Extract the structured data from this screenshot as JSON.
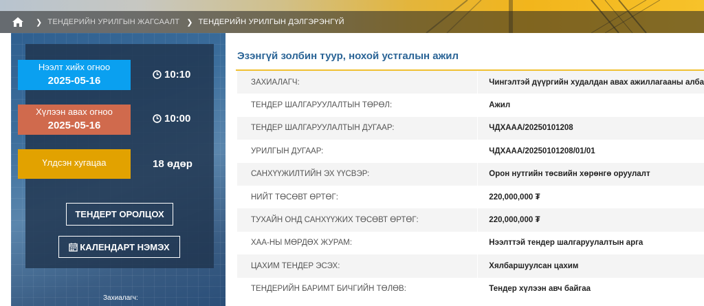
{
  "breadcrumb": {
    "items": [
      {
        "label": "ТЕНДЕРИЙН УРИЛГЫН ЖАГСААЛТ"
      },
      {
        "label": "ТЕНДЕРИЙН УРИЛГЫН ДЭЛГЭРЭНГҮЙ"
      }
    ]
  },
  "schedule": {
    "start": {
      "label": "Нээлт хийх огноо",
      "date": "2025-05-16",
      "time": "10:10",
      "color": "#0aa0f0"
    },
    "end": {
      "label": "Хүлээн авах огноо",
      "date": "2025-05-16",
      "time": "10:00",
      "color": "#d06a4d"
    },
    "remaining": {
      "label": "Үлдсэн хугацаа",
      "value": "18 өдөр",
      "color": "#e2a200"
    }
  },
  "actions": {
    "join_label": "ТЕНДЕРТ ОРОЛЦОХ",
    "calendar_label": "КАЛЕНДАРТ НЭМЭХ"
  },
  "sidebar_footer": {
    "customer_label": "Захиалагч:"
  },
  "tender": {
    "title": "Эзэнгүй золбин туур, нохой устгалын ажил",
    "rows": [
      {
        "key": "ЗАХИАЛАГЧ:",
        "value": "Чингэлтэй дүүргийн худалдан авах ажиллагааны алба"
      },
      {
        "key": "ТЕНДЕР ШАЛГАРУУЛАЛТЫН ТӨРӨЛ:",
        "value": "Ажил"
      },
      {
        "key": "ТЕНДЕР ШАЛГАРУУЛАЛТЫН ДУГААР:",
        "value": "ЧДХААА/20250101208"
      },
      {
        "key": "УРИЛГЫН ДУГААР:",
        "value": "ЧДХААА/20250101208/01/01"
      },
      {
        "key": "САНХҮҮЖИЛТИЙН ЭХ ҮҮСВЭР:",
        "value": "Орон нутгийн төсвийн хөрөнгө оруулалт"
      },
      {
        "key": "НИЙТ ТӨСӨВТ ӨРТӨГ:",
        "value": "220,000,000 ₮"
      },
      {
        "key": "ТУХАЙН ОНД САНХҮҮЖИХ ТӨСӨВТ ӨРТӨГ:",
        "value": "220,000,000 ₮"
      },
      {
        "key": "ХАА-НЫ МӨРДӨХ ЖУРАМ:",
        "value": "Нээлттэй тендер шалгаруулалтын арга"
      },
      {
        "key": "ЦАХИМ ТЕНДЕР ЭСЭХ:",
        "value": "Хялбаршуулсан цахим"
      },
      {
        "key": "ТЕНДЕРИЙН БАРИМТ БИЧГИЙН ТӨЛӨВ:",
        "value": "Тендер хүлээн авч байгаа"
      }
    ]
  },
  "colors": {
    "accent": "#f0c030",
    "title": "#2a6496",
    "panel": "#20344e"
  }
}
